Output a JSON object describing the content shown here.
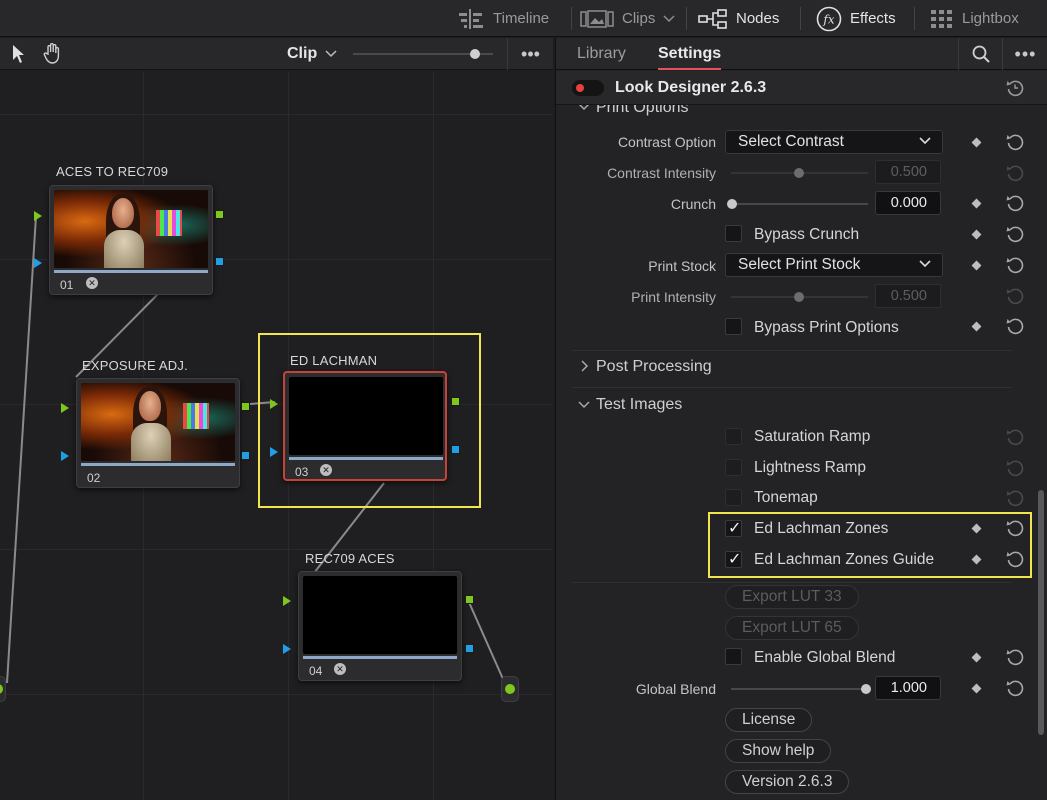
{
  "topbar": {
    "timeline": "Timeline",
    "clips": "Clips",
    "nodes": "Nodes",
    "effects": "Effects",
    "lightbox": "Lightbox"
  },
  "node_editor": {
    "mode_label": "Clip",
    "more": "•••",
    "nodes": [
      {
        "label": "ACES TO REC709",
        "number": "01",
        "fx": "✕"
      },
      {
        "label": "EXPOSURE ADJ.",
        "number": "02"
      },
      {
        "label": "ED LACHMAN",
        "number": "03",
        "fx": "✕"
      },
      {
        "label": "REC709 ACES",
        "number": "04",
        "fx": "✕"
      }
    ],
    "highlight_color": "#f2e64e"
  },
  "panel": {
    "tabs": [
      "Library",
      "Settings"
    ],
    "active_tab": "Settings",
    "more": "•••",
    "plugin_title": "Look Designer 2.6.3",
    "sections": {
      "print_options": "Print Options",
      "post_processing": "Post Processing",
      "test_images": "Test Images"
    },
    "contrast_option": {
      "label": "Contrast Option",
      "value": "Select Contrast"
    },
    "contrast_intensity": {
      "label": "Contrast Intensity",
      "value": "0.500"
    },
    "crunch": {
      "label": "Crunch",
      "value": "0.000"
    },
    "bypass_crunch": "Bypass Crunch",
    "print_stock": {
      "label": "Print Stock",
      "value": "Select Print Stock"
    },
    "print_intensity": {
      "label": "Print Intensity",
      "value": "0.500"
    },
    "bypass_print_options": "Bypass Print Options",
    "test_images": [
      {
        "label": "Saturation Ramp",
        "checked": false
      },
      {
        "label": "Lightness Ramp",
        "checked": false
      },
      {
        "label": "Tonemap",
        "checked": false
      },
      {
        "label": "Ed Lachman Zones",
        "checked": true
      },
      {
        "label": "Ed Lachman Zones Guide",
        "checked": true
      }
    ],
    "export_lut_33": "Export LUT 33",
    "export_lut_65": "Export LUT 65",
    "enable_global_blend": "Enable Global Blend",
    "global_blend": {
      "label": "Global Blend",
      "value": "1.000"
    },
    "license": "License",
    "show_help": "Show help",
    "version": "Version 2.6.3"
  }
}
